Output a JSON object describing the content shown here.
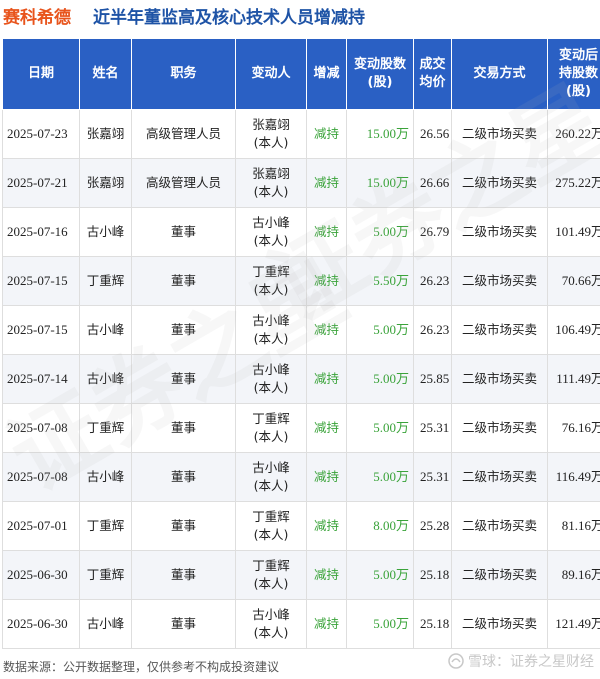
{
  "header": {
    "brand": "赛科希德",
    "title": "近半年董监高及核心技术人员增减持"
  },
  "table": {
    "columns": {
      "date": "日期",
      "name": "姓名",
      "role": "职务",
      "mover": "变动人",
      "direction": "增减",
      "shares_line1": "变动股数",
      "shares_line2": "(股)",
      "price_line1": "成交",
      "price_line2": "均价",
      "method": "交易方式",
      "after_line1": "变动后",
      "after_line2": "持股数",
      "after_line3": "(股)"
    },
    "rows": [
      {
        "date": "2025-07-23",
        "name": "张嘉翊",
        "role": "高级管理人员",
        "mover_name": "张嘉翊",
        "mover_rel": "(本人)",
        "direction": "减持",
        "shares": "15.00万",
        "price": "26.56",
        "method": "二级市场买卖",
        "after": "260.22万"
      },
      {
        "date": "2025-07-21",
        "name": "张嘉翊",
        "role": "高级管理人员",
        "mover_name": "张嘉翊",
        "mover_rel": "(本人)",
        "direction": "减持",
        "shares": "15.00万",
        "price": "26.66",
        "method": "二级市场买卖",
        "after": "275.22万"
      },
      {
        "date": "2025-07-16",
        "name": "古小峰",
        "role": "董事",
        "mover_name": "古小峰",
        "mover_rel": "(本人)",
        "direction": "减持",
        "shares": "5.00万",
        "price": "26.79",
        "method": "二级市场买卖",
        "after": "101.49万"
      },
      {
        "date": "2025-07-15",
        "name": "丁重辉",
        "role": "董事",
        "mover_name": "丁重辉",
        "mover_rel": "(本人)",
        "direction": "减持",
        "shares": "5.50万",
        "price": "26.23",
        "method": "二级市场买卖",
        "after": "70.66万"
      },
      {
        "date": "2025-07-15",
        "name": "古小峰",
        "role": "董事",
        "mover_name": "古小峰",
        "mover_rel": "(本人)",
        "direction": "减持",
        "shares": "5.00万",
        "price": "26.23",
        "method": "二级市场买卖",
        "after": "106.49万"
      },
      {
        "date": "2025-07-14",
        "name": "古小峰",
        "role": "董事",
        "mover_name": "古小峰",
        "mover_rel": "(本人)",
        "direction": "减持",
        "shares": "5.00万",
        "price": "25.85",
        "method": "二级市场买卖",
        "after": "111.49万"
      },
      {
        "date": "2025-07-08",
        "name": "丁重辉",
        "role": "董事",
        "mover_name": "丁重辉",
        "mover_rel": "(本人)",
        "direction": "减持",
        "shares": "5.00万",
        "price": "25.31",
        "method": "二级市场买卖",
        "after": "76.16万"
      },
      {
        "date": "2025-07-08",
        "name": "古小峰",
        "role": "董事",
        "mover_name": "古小峰",
        "mover_rel": "(本人)",
        "direction": "减持",
        "shares": "5.00万",
        "price": "25.31",
        "method": "二级市场买卖",
        "after": "116.49万"
      },
      {
        "date": "2025-07-01",
        "name": "丁重辉",
        "role": "董事",
        "mover_name": "丁重辉",
        "mover_rel": "(本人)",
        "direction": "减持",
        "shares": "8.00万",
        "price": "25.28",
        "method": "二级市场买卖",
        "after": "81.16万"
      },
      {
        "date": "2025-06-30",
        "name": "丁重辉",
        "role": "董事",
        "mover_name": "丁重辉",
        "mover_rel": "(本人)",
        "direction": "减持",
        "shares": "5.00万",
        "price": "25.18",
        "method": "二级市场买卖",
        "after": "89.16万"
      },
      {
        "date": "2025-06-30",
        "name": "古小峰",
        "role": "董事",
        "mover_name": "古小峰",
        "mover_rel": "(本人)",
        "direction": "减持",
        "shares": "5.00万",
        "price": "25.18",
        "method": "二级市场买卖",
        "after": "121.49万"
      }
    ]
  },
  "footer": {
    "source": "数据来源：公开数据整理，仅供参考不构成投资建议",
    "credit": "雪球：证券之星财经",
    "credit_icon": "snowball-icon"
  },
  "watermark": {
    "text_1": "证券之星",
    "text_2": "证券之星"
  },
  "colors": {
    "brand": "#e8541c",
    "title": "#1e53a6",
    "header_bg": "#2a60c4",
    "decrease": "#3aa33a"
  }
}
